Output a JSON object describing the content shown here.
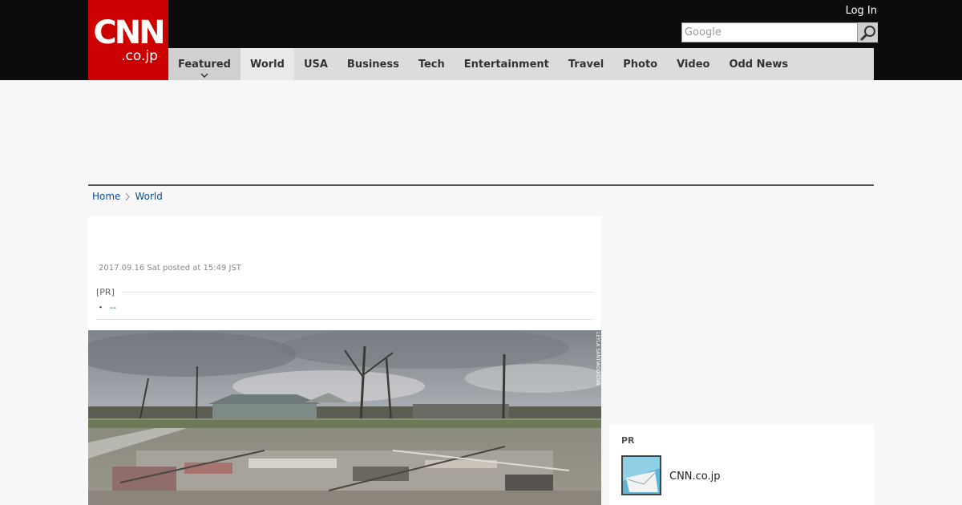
{
  "header": {
    "logo_top": "CNN",
    "logo_bottom": ".co.jp",
    "login_label": "Log In",
    "search_placeholder": "Google"
  },
  "nav": {
    "items": [
      {
        "label": "Featured"
      },
      {
        "label": "World"
      },
      {
        "label": "USA"
      },
      {
        "label": "Business"
      },
      {
        "label": "Tech"
      },
      {
        "label": "Entertainment"
      },
      {
        "label": "Travel"
      },
      {
        "label": "Photo"
      },
      {
        "label": "Video"
      },
      {
        "label": "Odd News"
      }
    ]
  },
  "breadcrumb": {
    "home": "Home",
    "section": "World"
  },
  "article": {
    "dateline": "2017.09.16 Sat posted at 15:49 JST",
    "pr_label": "[PR]",
    "pr_link_bullet": "・",
    "pr_link_text": "--",
    "photo_credit": "LEYLA SANTIAGO/CNN"
  },
  "sidebar": {
    "pr_title": "PR",
    "pr_item_name": "CNN.co.jp"
  },
  "colors": {
    "brand_red": "#cc0000",
    "topbar": "#0c0c0c",
    "nav_bg": "#dcdcdc",
    "link": "#0a4d8c"
  }
}
